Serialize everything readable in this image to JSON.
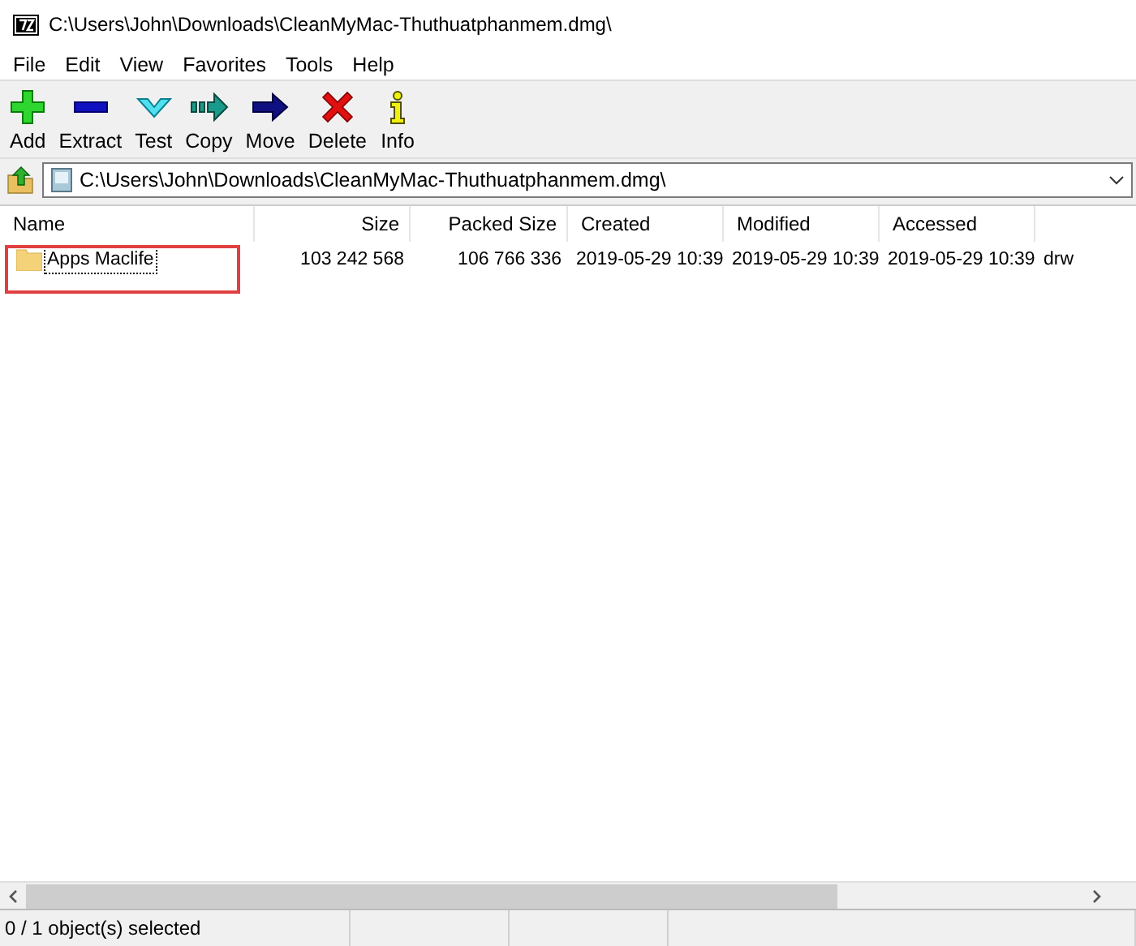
{
  "window": {
    "title": "C:\\Users\\John\\Downloads\\CleanMyMac-Thuthuatphanmem.dmg\\"
  },
  "menu": [
    "File",
    "Edit",
    "View",
    "Favorites",
    "Tools",
    "Help"
  ],
  "toolbar": [
    {
      "kind": "add",
      "label": "Add"
    },
    {
      "kind": "extract",
      "label": "Extract"
    },
    {
      "kind": "test",
      "label": "Test"
    },
    {
      "kind": "copy",
      "label": "Copy"
    },
    {
      "kind": "move",
      "label": "Move"
    },
    {
      "kind": "delete",
      "label": "Delete"
    },
    {
      "kind": "info",
      "label": "Info"
    }
  ],
  "address": {
    "value": "C:\\Users\\John\\Downloads\\CleanMyMac-Thuthuatphanmem.dmg\\"
  },
  "table": {
    "columns": [
      {
        "label": "Name",
        "kind": "text"
      },
      {
        "label": "Size",
        "kind": "number"
      },
      {
        "label": "Packed Size",
        "kind": "number"
      },
      {
        "label": "Created",
        "kind": "text"
      },
      {
        "label": "Modified",
        "kind": "text"
      },
      {
        "label": "Accessed",
        "kind": "text"
      }
    ],
    "rows": [
      {
        "kind": "folder",
        "selected": false,
        "focused": true,
        "highlighted": true,
        "cells": [
          "Apps Maclife",
          "103 242 568",
          "106 766 336",
          "2019-05-29 10:39",
          "2019-05-29 10:39",
          "2019-05-29 10:39",
          "drw"
        ]
      }
    ]
  },
  "status_bar": {
    "text": "0 / 1 object(s) selected"
  }
}
